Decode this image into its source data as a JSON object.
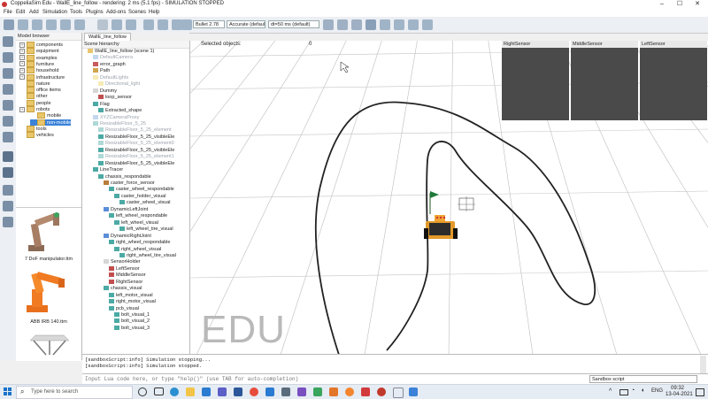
{
  "window": {
    "title": "CoppeliaSim Edu - WallE_line_follow - rendering: 2 ms (5.1 fps) - SIMULATION STOPPED",
    "controls": [
      "–",
      "☐",
      "✕"
    ]
  },
  "menu": [
    "File",
    "Edit",
    "Add",
    "Simulation",
    "Tools",
    "Plugins",
    "Add-ons",
    "Scenes",
    "Help"
  ],
  "toolbar": {
    "physics_engine": "Bullet 2.78",
    "accuracy": "Accurate (defaul",
    "timestep": "dt=50 ms (default)"
  },
  "model_browser": {
    "header": "Model browser",
    "items": [
      {
        "label": "components",
        "expandable": true
      },
      {
        "label": "equipment",
        "expandable": true
      },
      {
        "label": "examples",
        "expandable": true
      },
      {
        "label": "furniture",
        "expandable": true
      },
      {
        "label": "household",
        "expandable": true
      },
      {
        "label": "infrastructure",
        "expandable": true
      },
      {
        "label": "nature",
        "expandable": false
      },
      {
        "label": "office items",
        "expandable": false
      },
      {
        "label": "other",
        "expandable": false
      },
      {
        "label": "people",
        "expandable": false
      },
      {
        "label": "robots",
        "expandable": true
      },
      {
        "label": "mobile",
        "expandable": false
      },
      {
        "label": "non-mobile",
        "expandable": false,
        "selected": true
      },
      {
        "label": "tools",
        "expandable": false
      },
      {
        "label": "vehicles",
        "expandable": false
      }
    ],
    "thumbnails": [
      {
        "label": "7 DoF manipulator.ttm"
      },
      {
        "label": "ABB IRB 140.ttm"
      },
      {
        "label": ""
      }
    ]
  },
  "scene": {
    "tab": "WallE_line_follow",
    "header": "Scene hierarchy",
    "items": [
      {
        "label": "WallE_line_follow (scene 1)",
        "depth": 0,
        "icon": "scene",
        "faded": false
      },
      {
        "label": "DefaultCamera",
        "depth": 1,
        "icon": "camera",
        "faded": true
      },
      {
        "label": "error_graph",
        "depth": 1,
        "icon": "graph",
        "faded": false
      },
      {
        "label": "Path",
        "depth": 1,
        "icon": "path",
        "faded": false
      },
      {
        "label": "DefaultLights",
        "depth": 1,
        "icon": "light",
        "faded": true
      },
      {
        "label": "Directional_light",
        "depth": 2,
        "icon": "light",
        "faded": true
      },
      {
        "label": "Dummy",
        "depth": 1,
        "icon": "dummy",
        "faded": false
      },
      {
        "label": "loop_sensor",
        "depth": 2,
        "icon": "sensor",
        "faded": false
      },
      {
        "label": "Flag",
        "depth": 1,
        "icon": "shape",
        "faded": false
      },
      {
        "label": "Extracted_shape",
        "depth": 2,
        "icon": "shape",
        "faded": false
      },
      {
        "label": "XYZCameraProxy",
        "depth": 1,
        "icon": "camera",
        "faded": true
      },
      {
        "label": "ResizableFloor_5_25",
        "depth": 1,
        "icon": "shape",
        "faded": true
      },
      {
        "label": "ResizableFloor_5_25_element",
        "depth": 2,
        "icon": "shape",
        "faded": true
      },
      {
        "label": "ResizableFloor_5_25_visibleEle",
        "depth": 2,
        "icon": "shape",
        "faded": false
      },
      {
        "label": "ResizableFloor_5_25_element0",
        "depth": 2,
        "icon": "shape",
        "faded": true
      },
      {
        "label": "ResizableFloor_5_25_visibleEle",
        "depth": 2,
        "icon": "shape",
        "faded": false
      },
      {
        "label": "ResizableFloor_5_25_element1",
        "depth": 2,
        "icon": "shape",
        "faded": true
      },
      {
        "label": "ResizableFloor_5_25_visibleEle",
        "depth": 2,
        "icon": "shape",
        "faded": false
      },
      {
        "label": "LineTracer",
        "depth": 1,
        "icon": "shape",
        "faded": false
      },
      {
        "label": "chassis_respondable",
        "depth": 2,
        "icon": "shape",
        "faded": false
      },
      {
        "label": "caster_force_sensor",
        "depth": 3,
        "icon": "force",
        "faded": false
      },
      {
        "label": "caster_wheel_respondable",
        "depth": 4,
        "icon": "shape",
        "faded": false
      },
      {
        "label": "caster_holder_visual",
        "depth": 5,
        "icon": "shape",
        "faded": false
      },
      {
        "label": "caster_wheel_visual",
        "depth": 6,
        "icon": "shape",
        "faded": false
      },
      {
        "label": "DynamicLeftJoint",
        "depth": 3,
        "icon": "joint",
        "faded": false
      },
      {
        "label": "left_wheel_respondable",
        "depth": 4,
        "icon": "shape",
        "faded": false
      },
      {
        "label": "left_wheel_visual",
        "depth": 5,
        "icon": "shape",
        "faded": false
      },
      {
        "label": "left_wheel_tire_visual",
        "depth": 6,
        "icon": "shape",
        "faded": false
      },
      {
        "label": "DynamicRightJoint",
        "depth": 3,
        "icon": "joint",
        "faded": false
      },
      {
        "label": "right_wheel_respondable",
        "depth": 4,
        "icon": "shape",
        "faded": false
      },
      {
        "label": "right_wheel_visual",
        "depth": 5,
        "icon": "shape",
        "faded": false
      },
      {
        "label": "right_wheel_tire_visual",
        "depth": 6,
        "icon": "shape",
        "faded": false
      },
      {
        "label": "SensorHolder",
        "depth": 3,
        "icon": "dummy",
        "faded": false
      },
      {
        "label": "LeftSensor",
        "depth": 4,
        "icon": "sensor",
        "faded": false
      },
      {
        "label": "MiddleSensor",
        "depth": 4,
        "icon": "sensor",
        "faded": false
      },
      {
        "label": "RightSensor",
        "depth": 4,
        "icon": "sensor",
        "faded": false
      },
      {
        "label": "chassis_visual",
        "depth": 3,
        "icon": "shape",
        "faded": false
      },
      {
        "label": "left_motor_visual",
        "depth": 4,
        "icon": "shape",
        "faded": false
      },
      {
        "label": "right_motor_visual",
        "depth": 4,
        "icon": "shape",
        "faded": false
      },
      {
        "label": "pcb_visual",
        "depth": 4,
        "icon": "shape",
        "faded": false
      },
      {
        "label": "bolt_visual_1",
        "depth": 5,
        "icon": "shape",
        "faded": false
      },
      {
        "label": "bolt_visual_2",
        "depth": 5,
        "icon": "shape",
        "faded": false
      },
      {
        "label": "bolt_visual_3",
        "depth": 5,
        "icon": "shape",
        "faded": false
      }
    ]
  },
  "viewport": {
    "selected_label": "Selected objects:",
    "selected_count": "0",
    "watermark": "EDU",
    "sensor_views": [
      {
        "label": "RightSensor"
      },
      {
        "label": "MiddleSensor"
      },
      {
        "label": "LeftSensor"
      }
    ]
  },
  "console": {
    "lines": [
      "[sandboxScript:info]   Simulation stopping...",
      "[sandboxScript:info]   Simulation stopped."
    ],
    "input_placeholder": "Input Lua code here, or type \"help()\" (use TAB for auto-completion)",
    "script_selector": "Sandbox script"
  },
  "taskbar": {
    "search_placeholder": "Type here to search",
    "lang": "ENG",
    "time": "09:32",
    "date": "13-04-2021"
  },
  "colors": {
    "accent": "#3b82d8",
    "folder": "#e9c66b",
    "sensor_view_bg": "#4a4a4a",
    "track": "#222222"
  }
}
